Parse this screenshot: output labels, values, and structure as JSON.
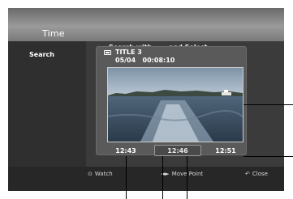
{
  "menu": {
    "title": "Time",
    "left_label": "Search",
    "instruction": "Search with ◄ ► and Select"
  },
  "title_info": {
    "title": "TITLE 3",
    "date_time": "05/04   00:08:10"
  },
  "times": {
    "previous": "12:43",
    "current": "12:46",
    "next": "12:51"
  },
  "hints": {
    "watch": "Watch",
    "move_point": "Move Point",
    "close": "Close"
  },
  "icons": {
    "watch": "enter-icon",
    "move_point": "left-right-arrows-icon",
    "close": "return-icon"
  },
  "colors": {
    "screen_bg": "#3b3b3b",
    "title_bar": "#8a8a8a",
    "text": "#ffffff"
  }
}
